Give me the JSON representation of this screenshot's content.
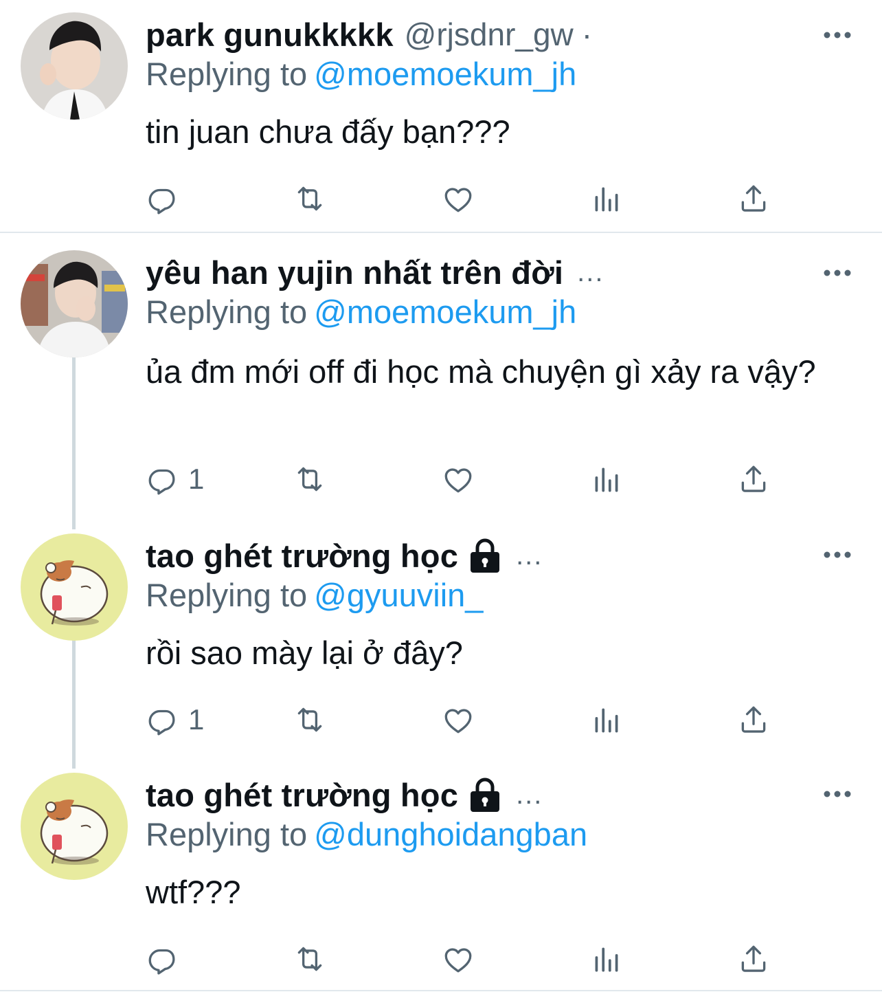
{
  "tweets": [
    {
      "display_name": "park gunukkkkk",
      "handle": "@rjsdnr_gw",
      "separator": "·",
      "replying_label": "Replying to",
      "replying_to": "@moemoekum_jh",
      "text": "tin juan chưa đấy bạn???",
      "reply_count": "",
      "avatar_icon": "user-photo-avatar"
    },
    {
      "display_name": "yêu han yujin nhất trên đời",
      "ellipsis": "...",
      "replying_label": "Replying to",
      "replying_to": "@moemoekum_jh",
      "text": "ủa đm mới off đi học mà chuyện gì xảy ra vậy?",
      "reply_count": "1",
      "avatar_icon": "user-photo-avatar"
    },
    {
      "display_name": "tao ghét trường học",
      "ellipsis": "...",
      "replying_label": "Replying to",
      "replying_to": "@gyuuviin_",
      "text": "rồi sao mày lại ở đây?",
      "reply_count": "1",
      "avatar_icon": "hamster-avatar",
      "locked": true
    },
    {
      "display_name": "tao ghét trường học",
      "ellipsis": "...",
      "replying_label": "Replying to",
      "replying_to": "@dunghoidangban",
      "text": "wtf???",
      "reply_count": "",
      "avatar_icon": "hamster-avatar",
      "locked": true
    }
  ],
  "colors": {
    "text": "#0f1419",
    "secondary": "#536471",
    "link": "#1d9bf0",
    "thread_line": "#cfd9de",
    "divider": "#e1e8ed"
  }
}
